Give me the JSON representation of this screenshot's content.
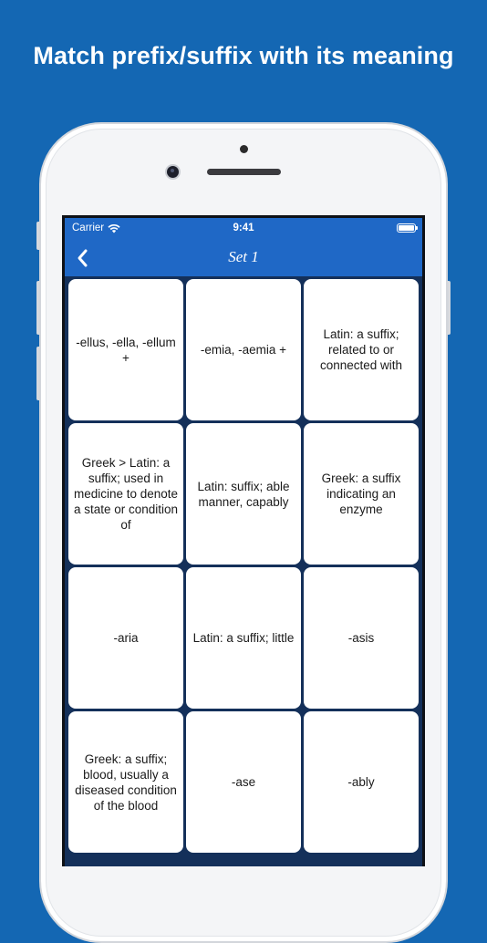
{
  "headline": "Match prefix/suffix with its meaning",
  "status_bar": {
    "carrier": "Carrier",
    "time": "9:41"
  },
  "nav": {
    "title": "Set 1",
    "back_icon": "chevron-left-icon"
  },
  "cards": [
    {
      "text": "-ellus, -ella, -ellum +"
    },
    {
      "text": "-emia, -aemia +"
    },
    {
      "text": "Latin: a suffix; related to or connected with"
    },
    {
      "text": "Greek > Latin: a suffix; used in medicine to denote a state or condition of"
    },
    {
      "text": "Latin: suffix; able manner, capably"
    },
    {
      "text": "Greek: a suffix indicating an enzyme"
    },
    {
      "text": "-aria"
    },
    {
      "text": "Latin: a suffix;  little"
    },
    {
      "text": "-asis"
    },
    {
      "text": "Greek: a suffix; blood, usually a diseased condition of the blood"
    },
    {
      "text": "-ase"
    },
    {
      "text": "-ably"
    }
  ],
  "colors": {
    "background": "#1467b3",
    "nav_bar": "#1f68c6",
    "grid_background": "#14305a",
    "card": "#ffffff"
  }
}
